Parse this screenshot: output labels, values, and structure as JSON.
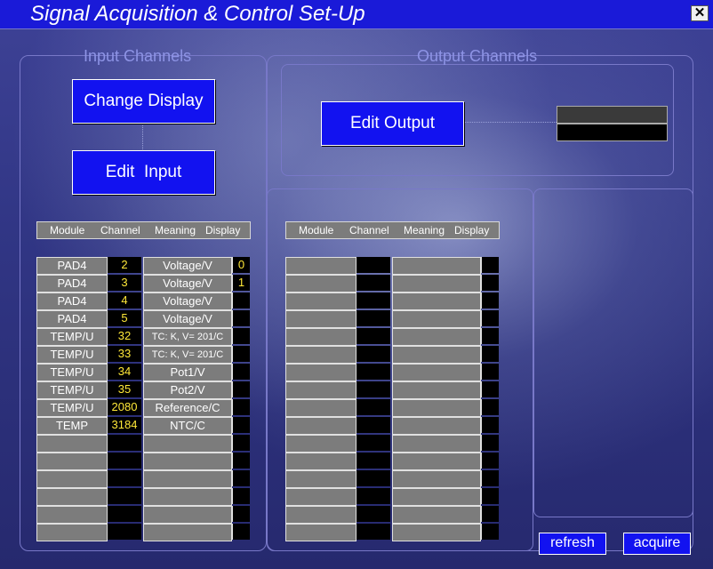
{
  "window": {
    "title": "Signal Acquisition & Control Set-Up",
    "close_label": "✕"
  },
  "input_group": {
    "label": "Input Channels",
    "change_display_label": "Change Display",
    "edit_input_label": "Edit  Input"
  },
  "output_group": {
    "label": "Output Channels",
    "edit_output_label": "Edit Output"
  },
  "columns": {
    "module": "Module",
    "channel": "Channel",
    "meaning": "Meaning",
    "display": "Display"
  },
  "input_table": {
    "rows": [
      {
        "module": "PAD4",
        "channel": "2",
        "meaning": "Voltage/V",
        "display": "0"
      },
      {
        "module": "PAD4",
        "channel": "3",
        "meaning": "Voltage/V",
        "display": "1"
      },
      {
        "module": "PAD4",
        "channel": "4",
        "meaning": "Voltage/V",
        "display": ""
      },
      {
        "module": "PAD4",
        "channel": "5",
        "meaning": "Voltage/V",
        "display": ""
      },
      {
        "module": "TEMP/U",
        "channel": "32",
        "meaning": "TC: K, V= 201/C",
        "display": ""
      },
      {
        "module": "TEMP/U",
        "channel": "33",
        "meaning": "TC: K, V= 201/C",
        "display": ""
      },
      {
        "module": "TEMP/U",
        "channel": "34",
        "meaning": "Pot1/V",
        "display": ""
      },
      {
        "module": "TEMP/U",
        "channel": "35",
        "meaning": "Pot2/V",
        "display": ""
      },
      {
        "module": "TEMP/U",
        "channel": "2080",
        "meaning": "Reference/C",
        "display": ""
      },
      {
        "module": "TEMP",
        "channel": "3184",
        "meaning": "NTC/C",
        "display": ""
      },
      {
        "module": "",
        "channel": "",
        "meaning": "",
        "display": ""
      },
      {
        "module": "",
        "channel": "",
        "meaning": "",
        "display": ""
      },
      {
        "module": "",
        "channel": "",
        "meaning": "",
        "display": ""
      },
      {
        "module": "",
        "channel": "",
        "meaning": "",
        "display": ""
      },
      {
        "module": "",
        "channel": "",
        "meaning": "",
        "display": ""
      },
      {
        "module": "",
        "channel": "",
        "meaning": "",
        "display": ""
      }
    ]
  },
  "output_table": {
    "rows": [
      {
        "module": "",
        "channel": "",
        "meaning": "",
        "display": ""
      },
      {
        "module": "",
        "channel": "",
        "meaning": "",
        "display": ""
      },
      {
        "module": "",
        "channel": "",
        "meaning": "",
        "display": ""
      },
      {
        "module": "",
        "channel": "",
        "meaning": "",
        "display": ""
      },
      {
        "module": "",
        "channel": "",
        "meaning": "",
        "display": ""
      },
      {
        "module": "",
        "channel": "",
        "meaning": "",
        "display": ""
      },
      {
        "module": "",
        "channel": "",
        "meaning": "",
        "display": ""
      },
      {
        "module": "",
        "channel": "",
        "meaning": "",
        "display": ""
      },
      {
        "module": "",
        "channel": "",
        "meaning": "",
        "display": ""
      },
      {
        "module": "",
        "channel": "",
        "meaning": "",
        "display": ""
      },
      {
        "module": "",
        "channel": "",
        "meaning": "",
        "display": ""
      },
      {
        "module": "",
        "channel": "",
        "meaning": "",
        "display": ""
      },
      {
        "module": "",
        "channel": "",
        "meaning": "",
        "display": ""
      },
      {
        "module": "",
        "channel": "",
        "meaning": "",
        "display": ""
      },
      {
        "module": "",
        "channel": "",
        "meaning": "",
        "display": ""
      },
      {
        "module": "",
        "channel": "",
        "meaning": "",
        "display": ""
      }
    ]
  },
  "footer": {
    "refresh_label": "refresh",
    "acquire_label": "acquire"
  },
  "colors": {
    "title_bar": "#1a1ad8",
    "button": "#1212f0",
    "channel_text": "#ffe838",
    "group_label": "#8e94e6"
  }
}
